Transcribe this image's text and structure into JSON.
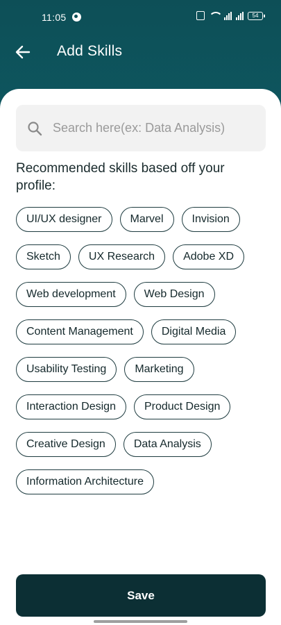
{
  "status_bar": {
    "time": "11:05",
    "battery": "54"
  },
  "app_bar": {
    "back_icon": "arrow-left-icon",
    "title": "Add Skills"
  },
  "search": {
    "icon": "search-icon",
    "placeholder": "Search here(ex: Data Analysis)",
    "value": ""
  },
  "recommend": {
    "heading": "Recommended skills based off your profile:"
  },
  "skills": [
    "UI/UX designer",
    "Marvel",
    "Invision",
    "Sketch",
    "UX Research",
    "Adobe XD",
    "Web development",
    "Web Design",
    "Content Management",
    "Digital Media",
    "Usability Testing",
    "Marketing",
    "Interaction Design",
    "Product Design",
    "Creative Design",
    "Data Analysis",
    "Information Architecture"
  ],
  "actions": {
    "save_label": "Save"
  },
  "colors": {
    "header_gradient_top": "#0d4f57",
    "header_gradient_bottom": "#12808a",
    "chip_border": "#1d3b3f",
    "save_button": "#0c2f34"
  }
}
